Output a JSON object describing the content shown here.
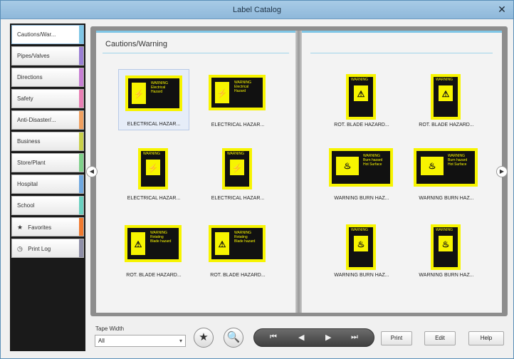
{
  "window": {
    "title": "Label Catalog",
    "close_glyph": "✕"
  },
  "sidebar": {
    "items": [
      {
        "label": "Cautions/War...",
        "color": "#7fc6e6",
        "active": true
      },
      {
        "label": "Pipes/Valves",
        "color": "#9a7fd4"
      },
      {
        "label": "Directions",
        "color": "#c77fd4"
      },
      {
        "label": "Safety",
        "color": "#e87fb4"
      },
      {
        "label": "Anti-Disaster/...",
        "color": "#f0a060"
      },
      {
        "label": "Business",
        "color": "#c9d04a"
      },
      {
        "label": "Store/Plant",
        "color": "#7fd08a"
      },
      {
        "label": "Hospital",
        "color": "#6fa8e0"
      },
      {
        "label": "School",
        "color": "#6ad0c0"
      },
      {
        "label": "Favorites",
        "color": "#f07a30",
        "icon": "star-icon"
      },
      {
        "label": "Print Log",
        "color": "#8f8fa8",
        "icon": "clock-icon"
      }
    ]
  },
  "page": {
    "heading": "Cautions/Warning",
    "left_items": [
      {
        "caption": "ELECTRICAL HAZAR..."
      },
      {
        "caption": "ELECTRICAL HAZAR..."
      },
      {
        "caption": "ELECTRICAL HAZAR..."
      },
      {
        "caption": "ELECTRICAL HAZAR..."
      },
      {
        "caption": "ROT. BLADE HAZARD..."
      },
      {
        "caption": "ROT. BLADE HAZARD..."
      }
    ],
    "right_items": [
      {
        "caption": "ROT. BLADE HAZARD..."
      },
      {
        "caption": "ROT. BLADE HAZARD..."
      },
      {
        "caption": "WARNING BURN HAZ..."
      },
      {
        "caption": "WARNING BURN HAZ..."
      },
      {
        "caption": "WARNING BURN HAZ..."
      },
      {
        "caption": "WARNING BURN HAZ..."
      }
    ]
  },
  "toolbar": {
    "tape_width_label": "Tape Width",
    "tape_width_value": "All",
    "print_label": "Print",
    "edit_label": "Edit",
    "help_label": "Help"
  },
  "colors": {
    "accent": "#7fc6e6",
    "sign_yellow": "#f7f400"
  }
}
